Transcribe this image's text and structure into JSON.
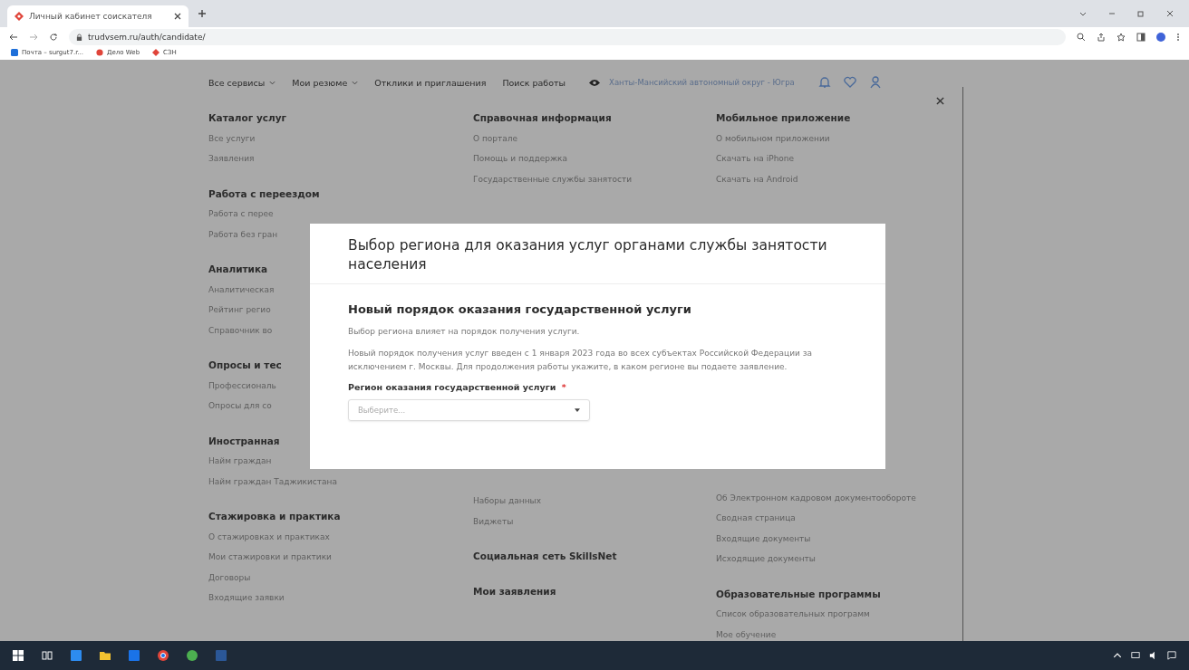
{
  "browser": {
    "tab_title": "Личный кабинет соискателя",
    "url": "trudvsem.ru/auth/candidate/",
    "bookmarks": [
      "Почта – surgut7.r...",
      "Дело Web",
      "СЗН"
    ]
  },
  "nav": {
    "items": [
      {
        "label": "Все сервисы",
        "dropdown": true
      },
      {
        "label": "Мои резюме",
        "dropdown": true
      },
      {
        "label": "Отклики и приглашения",
        "dropdown": false
      },
      {
        "label": "Поиск работы",
        "dropdown": false
      }
    ],
    "region": "Ханты-Мансийский автономный округ - Югра"
  },
  "menu": {
    "columns": [
      {
        "top": [
          {
            "kind": "heading",
            "text": "Каталог услуг"
          },
          {
            "kind": "link",
            "text": "Все услуги"
          },
          {
            "kind": "link",
            "text": "Заявления"
          },
          {
            "kind": "heading",
            "text": "Работа с переездом"
          },
          {
            "kind": "link",
            "text": "Работа с перее"
          },
          {
            "kind": "link",
            "text": "Работа без гран"
          },
          {
            "kind": "heading",
            "text": "Аналитика"
          },
          {
            "kind": "link",
            "text": "Аналитическая"
          },
          {
            "kind": "link",
            "text": "Рейтинг регио"
          },
          {
            "kind": "link",
            "text": "Справочник во"
          },
          {
            "kind": "heading",
            "text": "Опросы и тес"
          },
          {
            "kind": "link",
            "text": "Профессиональ"
          },
          {
            "kind": "link",
            "text": "Опросы для со"
          },
          {
            "kind": "heading",
            "text": "Иностранная"
          },
          {
            "kind": "link",
            "text": "Найм граждан"
          },
          {
            "kind": "link",
            "text": "Найм граждан Таджикистана"
          },
          {
            "kind": "heading",
            "text": "Стажировка и практика"
          },
          {
            "kind": "link",
            "text": "О стажировках и практиках"
          },
          {
            "kind": "link",
            "text": "Мои стажировки и практики"
          },
          {
            "kind": "link",
            "text": "Договоры"
          },
          {
            "kind": "link",
            "text": "Входящие заявки"
          }
        ]
      },
      {
        "top": [
          {
            "kind": "heading",
            "text": "Справочная информация"
          },
          {
            "kind": "link",
            "text": "О портале"
          },
          {
            "kind": "link",
            "text": "Помощь и поддержка"
          },
          {
            "kind": "link",
            "text": "Государственные службы занятости"
          }
        ],
        "bottom": [
          {
            "kind": "link",
            "text": "Наборы данных"
          },
          {
            "kind": "link",
            "text": "Виджеты"
          },
          {
            "kind": "heading",
            "text": "Социальная сеть SkillsNet"
          },
          {
            "kind": "heading",
            "text": "Мои заявления"
          }
        ]
      },
      {
        "top": [
          {
            "kind": "heading",
            "text": "Мобильное приложение"
          },
          {
            "kind": "link",
            "text": "О мобильном приложении"
          },
          {
            "kind": "link",
            "text": "Скачать на iPhone"
          },
          {
            "kind": "link",
            "text": "Скачать на Android"
          }
        ],
        "bottom": [
          {
            "kind": "link",
            "text": "Об Электронном кадровом документообороте"
          },
          {
            "kind": "link",
            "text": "Сводная страница"
          },
          {
            "kind": "link",
            "text": "Входящие документы"
          },
          {
            "kind": "link",
            "text": "Исходящие документы"
          },
          {
            "kind": "heading",
            "text": "Образовательные программы"
          },
          {
            "kind": "link",
            "text": "Список образовательных программ"
          },
          {
            "kind": "link",
            "text": "Мое обучение"
          }
        ]
      }
    ]
  },
  "modal": {
    "title": "Выбор региона для оказания услуг органами службы занятости населения",
    "subtitle": "Новый порядок оказания государственной услуги",
    "paragraphs": [
      "Выбор региона влияет на порядок получения услуги.",
      "Новый порядок получения услуг введен с 1 января 2023 года во всех субъектах Российской Федерации за исключением г. Москвы. Для продолжения работы укажите, в каком регионе вы подаете заявление."
    ],
    "field_label": "Регион оказания государственной услуги",
    "required_mark": "*",
    "select_placeholder": "Выберите..."
  }
}
